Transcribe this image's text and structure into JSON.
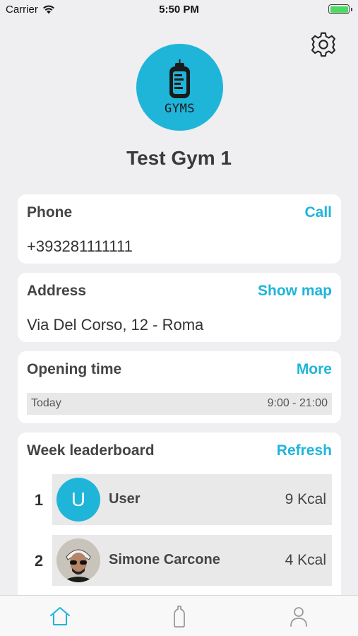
{
  "status_bar": {
    "carrier": "Carrier",
    "time": "5:50 PM",
    "battery_level": 1.0
  },
  "header": {
    "logo_text": "GYMS",
    "gym_name": "Test Gym 1"
  },
  "phone_card": {
    "title": "Phone",
    "action": "Call",
    "value": "+393281111111"
  },
  "address_card": {
    "title": "Address",
    "action": "Show map",
    "value": "Via Del Corso, 12 - Roma"
  },
  "opening_card": {
    "title": "Opening time",
    "action": "More",
    "day": "Today",
    "hours": "9:00 - 21:00"
  },
  "leaderboard": {
    "title": "Week leaderboard",
    "action": "Refresh",
    "rows": [
      {
        "rank": "1",
        "initial": "U",
        "name": "User",
        "score": "9 Kcal"
      },
      {
        "rank": "2",
        "initial": "",
        "name": "Simone Carcone",
        "score": "4 Kcal"
      }
    ]
  },
  "tabbar": {
    "items": [
      "home-icon",
      "bottle-icon",
      "profile-icon"
    ],
    "active_color": "#1fb5d9",
    "inactive_color": "#9a9a9a"
  },
  "colors": {
    "accent": "#1fb5d9",
    "background": "#efeef0",
    "card": "#ffffff"
  }
}
